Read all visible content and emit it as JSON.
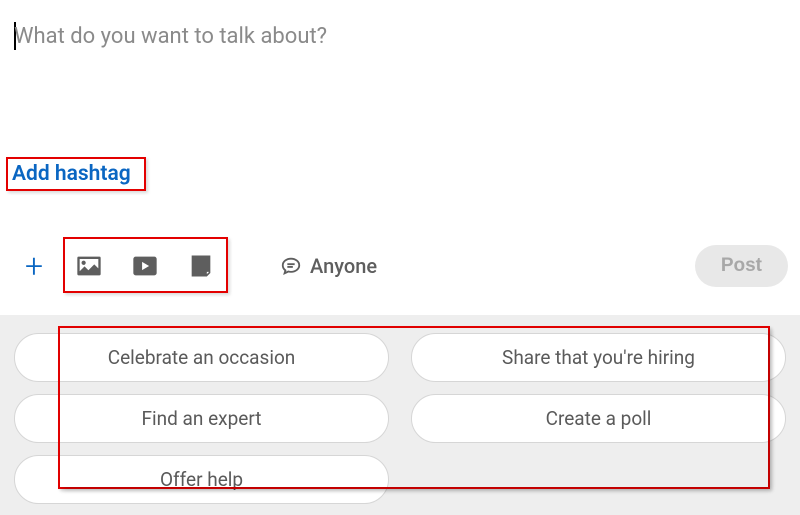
{
  "composer": {
    "placeholder": "What do you want to talk about?",
    "value": ""
  },
  "hashtag_link": "Add hashtag",
  "toolbar": {
    "plus_label": "+",
    "visibility_label": "Anyone",
    "post_label": "Post"
  },
  "icons": {
    "photo": "photo-icon",
    "video": "video-icon",
    "document": "document-icon",
    "comment": "comment-icon",
    "plus": "plus-icon"
  },
  "suggestions": {
    "items": [
      "Celebrate an occasion",
      "Share that you're hiring",
      "Find an expert",
      "Create a poll",
      "Offer help"
    ]
  }
}
